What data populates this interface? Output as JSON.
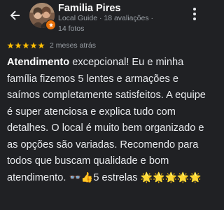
{
  "reviewer": {
    "name": "Familia Pires",
    "meta": "Local Guide · 18 avaliações · 14 fotos"
  },
  "rating": {
    "stars": 5,
    "max": 5,
    "time_ago": "2 meses atrás"
  },
  "review": {
    "lead": "Atendimento",
    "body": " excepcional! Eu e minha família fizemos 5 lentes e armações e saímos completamente satisfeitos. A equipe é super atenciosa e explica tudo com detalhes. O local é muito bem organizado e as opções são variadas. Recomendo para todos que buscam qualidade e bom atendimento. ",
    "emoji_glasses": "👓",
    "emoji_thumb": "👍",
    "tail": "5 estrelas ",
    "emoji_stars": "🌟🌟🌟🌟🌟"
  },
  "colors": {
    "background": "#202124",
    "star": "#fbbc04",
    "muted": "#9aa0a6",
    "badge": "#e8710a"
  },
  "icons": {
    "back": "arrow-left-icon",
    "more": "more-vert-icon",
    "badge": "local-guide-badge-icon"
  }
}
